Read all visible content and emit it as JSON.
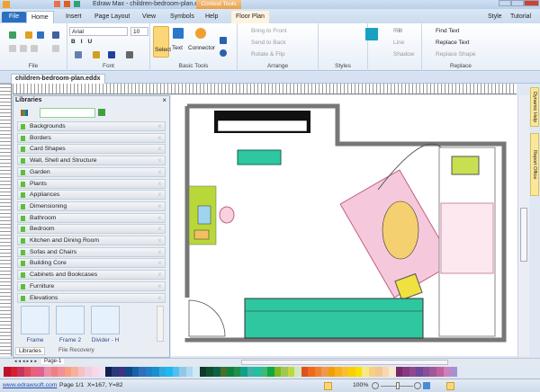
{
  "titlebar": {
    "title": "Edraw Max - children-bedroom-plan.eddx",
    "context_tools": "Context Tools"
  },
  "tabs": {
    "file": "File",
    "home": "Home",
    "insert": "Insert",
    "page_layout": "Page Layout",
    "view": "View",
    "symbols": "Symbols",
    "help": "Help",
    "floor_plan": "Floor Plan",
    "style": "Style",
    "tutorial": "Tutorial"
  },
  "ribbon": {
    "file_group": "File",
    "font": {
      "name": "Arial",
      "size": "10",
      "label": "Font"
    },
    "basic_tools": {
      "select": "Select",
      "text": "Text",
      "connector": "Connector",
      "label": "Basic Tools"
    },
    "arrange": {
      "bring_front": "Bring to Front",
      "send_back": "Send to Back",
      "rotate_flip": "Rotate & Flip",
      "label": "Arrange"
    },
    "styles": {
      "fill": "Fill",
      "line": "Line",
      "shadow": "Shadow",
      "label": "Styles"
    },
    "replace": {
      "find_text": "Find Text",
      "replace_text": "Replace Text",
      "replace_shape": "Replace Shape",
      "label": "Replace"
    }
  },
  "document": {
    "tab": "children-bedroom-plan.eddx"
  },
  "libraries": {
    "title": "Libraries",
    "search_value": "",
    "items": [
      "Backgrounds",
      "Borders",
      "Card Shapes",
      "Wall, Shell and Structure",
      "Garden",
      "Plants",
      "Appliances",
      "Dimensioning",
      "Bathroom",
      "Bedroom",
      "Kitchen and Dining Room",
      "Sofas and Chairs",
      "Building Core",
      "Cabinets and Bookcases",
      "Furniture",
      "Elevations"
    ],
    "shapes": [
      "Frame",
      "Frame 2",
      "Divider - H"
    ],
    "bottom_tabs": [
      "Libraries",
      "File Recovery"
    ]
  },
  "side_tabs": [
    "Dynamic Help",
    "Report Office"
  ],
  "pagebar": {
    "page_tab": "Page-1"
  },
  "palette": [
    "#c0102a",
    "#d81e2f",
    "#c8345a",
    "#e04a60",
    "#e8607a",
    "#e06090",
    "#e890a8",
    "#f08080",
    "#f09098",
    "#f8a080",
    "#f8b0a0",
    "#f8c0c0",
    "#f0d0e0",
    "#f8d8e8",
    "#f0e0f0",
    "#102050",
    "#283878",
    "#403080",
    "#104888",
    "#1860a8",
    "#3070b8",
    "#2080c8",
    "#1890d0",
    "#30a8e0",
    "#20b8f0",
    "#50c0f0",
    "#90c8e8",
    "#b0d8f0",
    "#d0e8f8",
    "#103828",
    "#105030",
    "#106048",
    "#487028",
    "#108040",
    "#209048",
    "#10a088",
    "#40b0a8",
    "#20c0a0",
    "#40b878",
    "#10a840",
    "#80b820",
    "#a0c850",
    "#c0d840",
    "#d0e8c0",
    "#e05020",
    "#f06818",
    "#f08030",
    "#f09850",
    "#f0a000",
    "#f8b020",
    "#f8c030",
    "#f8d000",
    "#f8e000",
    "#f8e880",
    "#f8d080",
    "#f0c890",
    "#f8d8b0",
    "#f8e8d0",
    "#782868",
    "#883880",
    "#904890",
    "#704898",
    "#885098",
    "#a05898",
    "#c060a0",
    "#d080b8",
    "#a890d0"
  ],
  "status": {
    "link": "www.edrawsoft.com",
    "page": "Page 1/1",
    "coords": "X=167, Y=82",
    "zoom": "100%"
  }
}
